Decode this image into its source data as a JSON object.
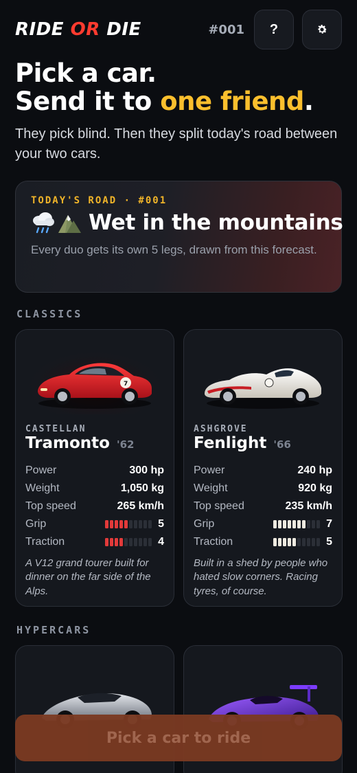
{
  "header": {
    "logo_part1": "RIDE ",
    "logo_part2": "OR",
    "logo_part3": " DIE",
    "issue": "#001",
    "help_label": "?",
    "settings_icon": "gear-icon"
  },
  "hero": {
    "line1": "Pick a car.",
    "line2_prefix": "Send it to ",
    "line2_highlight": "one friend",
    "line2_suffix": ".",
    "subtitle": "They pick blind. Then they split today's road between your two cars."
  },
  "road": {
    "kicker": "TODAY'S ROAD · #001",
    "weather_icons": [
      "rain-cloud-icon",
      "mountain-icon"
    ],
    "title": "Wet in the mountains",
    "description": "Every duo gets its own 5 legs, drawn from this forecast."
  },
  "sections": {
    "classics": "CLASSICS",
    "hypercars": "HYPERCARS"
  },
  "cars": [
    {
      "make": "CASTELLAN",
      "model": "Tramonto",
      "year": "'62",
      "color": "#d11e24",
      "stats": [
        {
          "label": "Power",
          "value": "300 hp"
        },
        {
          "label": "Weight",
          "value": "1,050 kg"
        },
        {
          "label": "Top speed",
          "value": "265 km/h"
        }
      ],
      "grip": {
        "label": "Grip",
        "value": "5",
        "level": 5
      },
      "traction": {
        "label": "Traction",
        "value": "4",
        "level": 4
      },
      "bar_color": "#e23a3a",
      "blurb": "A V12 grand tourer built for dinner on the far side of the Alps."
    },
    {
      "make": "ASHGROVE",
      "model": "Fenlight",
      "year": "'66",
      "color": "#f0ece4",
      "stats": [
        {
          "label": "Power",
          "value": "240 hp"
        },
        {
          "label": "Weight",
          "value": "920 kg"
        },
        {
          "label": "Top speed",
          "value": "235 km/h"
        }
      ],
      "grip": {
        "label": "Grip",
        "value": "7",
        "level": 7
      },
      "traction": {
        "label": "Traction",
        "value": "5",
        "level": 5
      },
      "bar_color": "#eeeae0",
      "blurb": "Built in a shed by people who hated slow corners. Racing tyres, of course."
    }
  ],
  "cta": {
    "label": "Pick a car to ride"
  }
}
